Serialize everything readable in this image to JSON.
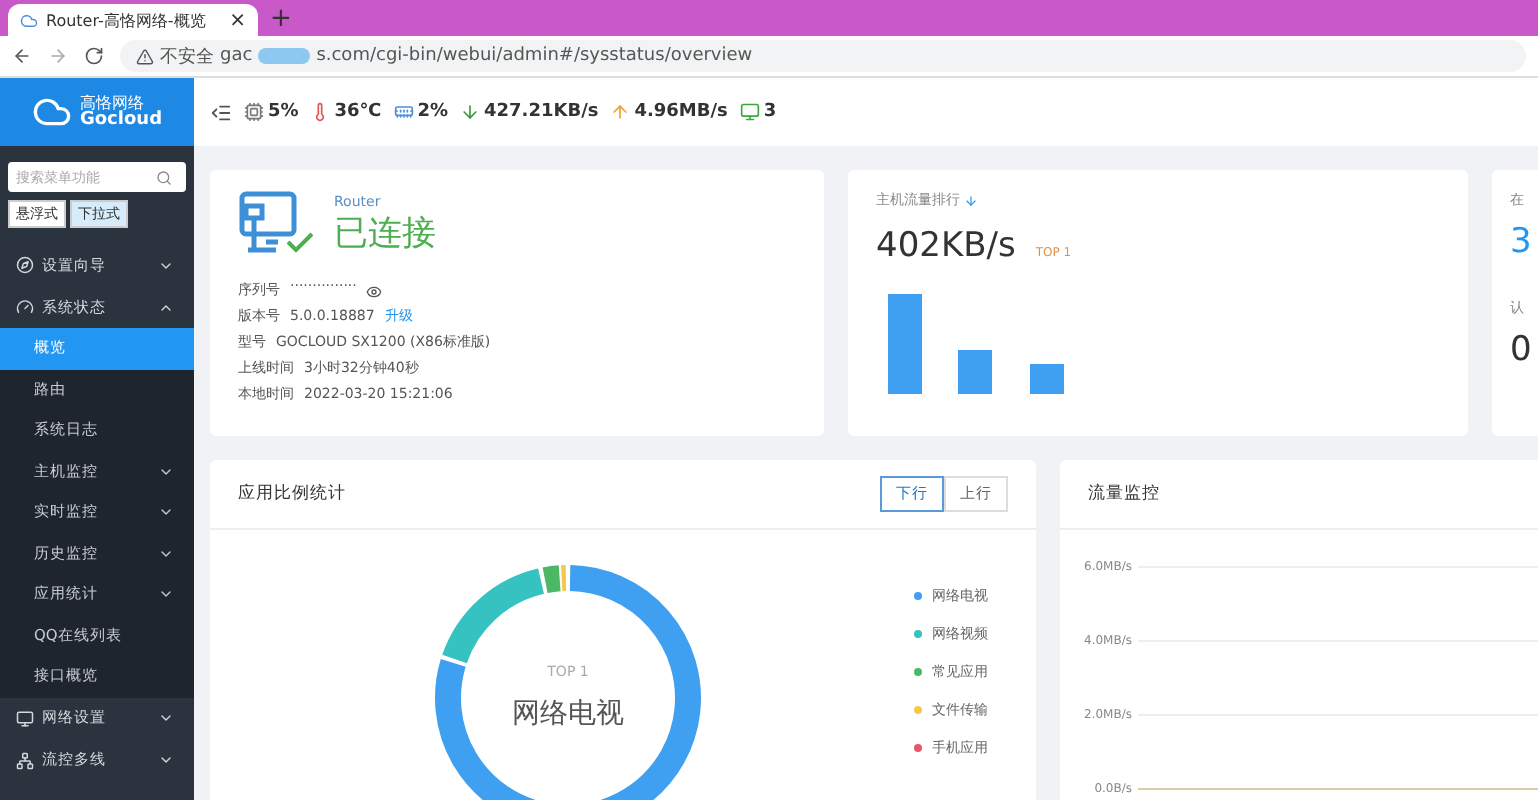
{
  "browser": {
    "tab_title": "Router-高恪网络-概览",
    "new_tab": "+",
    "close": "×",
    "security": "不安全",
    "url_start": "gac",
    "url_end": "s.com/cgi-bin/webui/admin#/sysstatus/overview"
  },
  "logo": {
    "name": "高恪网络",
    "latin": "Gocloud"
  },
  "status": [
    {
      "kind": "cpu",
      "value": "5%"
    },
    {
      "kind": "temperature",
      "value": "36℃"
    },
    {
      "kind": "memory",
      "value": "2%"
    },
    {
      "kind": "download",
      "value": "427.21KB/s"
    },
    {
      "kind": "upload",
      "value": "4.96MB/s"
    },
    {
      "kind": "devices",
      "value": "3"
    }
  ],
  "sidebar": {
    "search": {
      "placeholder": "搜索菜单功能"
    },
    "modes": [
      {
        "label": "悬浮式",
        "selected": false
      },
      {
        "label": "下拉式",
        "selected": true
      }
    ],
    "items": [
      {
        "label": "设置向导",
        "expanded": false,
        "has_children": true
      },
      {
        "label": "系统状态",
        "expanded": true,
        "has_children": true,
        "children": [
          {
            "label": "概览",
            "selected": true,
            "has_children": false
          },
          {
            "label": "路由",
            "selected": false,
            "has_children": false
          },
          {
            "label": "系统日志",
            "selected": false,
            "has_children": false
          },
          {
            "label": "主机监控",
            "selected": false,
            "has_children": true
          },
          {
            "label": "实时监控",
            "selected": false,
            "has_children": true
          },
          {
            "label": "历史监控",
            "selected": false,
            "has_children": true
          },
          {
            "label": "应用统计",
            "selected": false,
            "has_children": true
          },
          {
            "label": "QQ在线列表",
            "selected": false,
            "has_children": false
          },
          {
            "label": "接口概览",
            "selected": false,
            "has_children": false
          }
        ]
      },
      {
        "label": "网络设置",
        "expanded": false,
        "has_children": true
      },
      {
        "label": "流控多线",
        "expanded": false,
        "has_children": true
      }
    ]
  },
  "device": {
    "brand": "Router",
    "status": "已连接",
    "fields": [
      {
        "label": "序列号",
        "value": "···············",
        "kind": "masked"
      },
      {
        "label": "版本号",
        "value": "5.0.0.18887",
        "link": "升级"
      },
      {
        "label": "型号",
        "value": "GOCLOUD SX1200 (X86标准版)"
      },
      {
        "label": "上线时间",
        "value": "3小时32分钟40秒"
      },
      {
        "label": "本地时间",
        "value": "2022-03-20 15:21:06"
      }
    ]
  },
  "host_traffic": {
    "title": "主机流量排行",
    "value": "402KB/s",
    "badge": "TOP 1"
  },
  "side_stats": [
    {
      "label": "在",
      "value": "3",
      "highlight": true
    },
    {
      "label": "认",
      "value": "0",
      "highlight": false
    }
  ],
  "app_stats": {
    "title": "应用比例统计",
    "directions": [
      {
        "label": "下行",
        "selected": true
      },
      {
        "label": "上行",
        "selected": false
      }
    ],
    "center_top": "TOP 1",
    "center_name": "网络电视",
    "legend": [
      {
        "label": "网络电视",
        "color": "#3fa0f2"
      },
      {
        "label": "网络视频",
        "color": "#36c2c0"
      },
      {
        "label": "常见应用",
        "color": "#4cb865"
      },
      {
        "label": "文件传输",
        "color": "#f2c94c"
      },
      {
        "label": "手机应用",
        "color": "#e8566c"
      }
    ]
  },
  "traffic": {
    "title": "流量监控",
    "y_labels": [
      "6.0MB/s",
      "4.0MB/s",
      "2.0MB/s",
      "0.0B/s"
    ]
  }
}
